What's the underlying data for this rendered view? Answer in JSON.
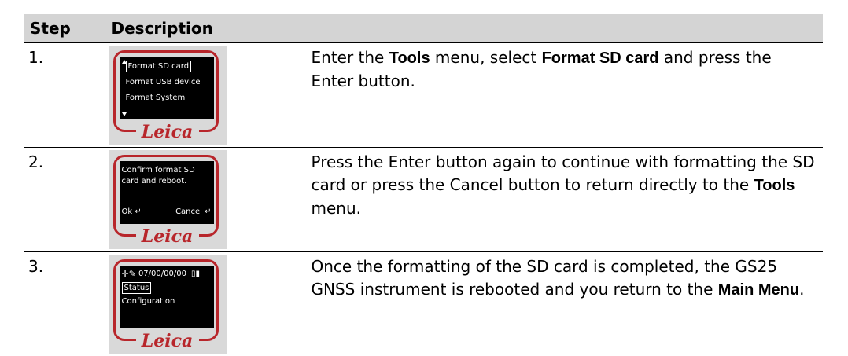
{
  "table": {
    "headers": [
      "Step",
      "Description"
    ],
    "rows": [
      {
        "step": "1.",
        "screen": {
          "lines": [
            "Format SD card",
            "Format USB device",
            "Format System"
          ]
        },
        "logo": "Leica",
        "desc_parts": [
          "Enter the ",
          "Tools",
          " menu, select ",
          "Format SD card",
          " and press the Enter button."
        ]
      },
      {
        "step": "2.",
        "screen": {
          "lines": [
            "Confirm format SD",
            "card and reboot.",
            "Ok ↵",
            "Cancel ↵"
          ]
        },
        "logo": "Leica",
        "desc_parts": [
          "Press the Enter button again to continue with formatting the SD card or press the Cancel button to return directly to the ",
          "Tools",
          " menu."
        ]
      },
      {
        "step": "3.",
        "screen": {
          "lines": [
            "07/00/00/00",
            "Status",
            "Configuration"
          ]
        },
        "logo": "Leica",
        "desc_parts": [
          "Once the formatting of the SD card is completed, the GS25 GNSS instrument is rebooted and you return to the ",
          "Main Menu",
          "."
        ]
      }
    ]
  },
  "colors": {
    "header_bg": "#d4d4d4",
    "brand_red": "#b8262b"
  }
}
